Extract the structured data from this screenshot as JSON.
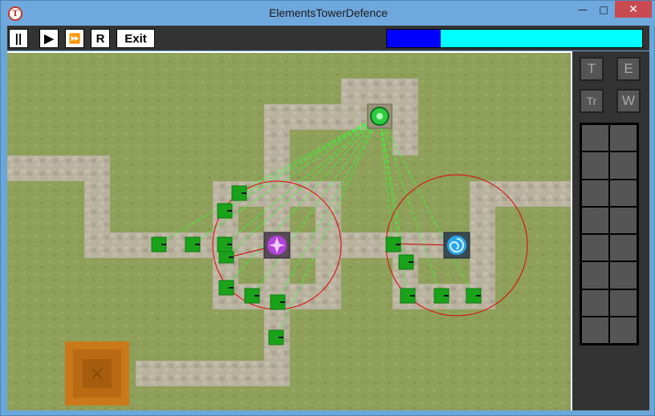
{
  "window": {
    "title": "ElementsTowerDefence",
    "minimize_glyph": "—",
    "maximize_glyph": "□",
    "close_glyph": "✕"
  },
  "toolbar": {
    "pause_label": "||",
    "play_label": "▶",
    "fast_forward_label": "⏩",
    "restart_label": "R",
    "exit_label": "Exit",
    "wave_progress": 0.21,
    "colors": {
      "progress_fill": "#0000ff",
      "progress_track": "#00ffff"
    }
  },
  "tower_buttons": [
    "T",
    "E",
    "Tr",
    "W"
  ],
  "inventory": {
    "slots": 16
  },
  "colors": {
    "grass": "#8fa05b",
    "path": "#b7b19e",
    "enemy": "#1aa31a",
    "range_circle": "#ff0000",
    "laser": "#33ff33",
    "base": "#c9781a"
  }
}
